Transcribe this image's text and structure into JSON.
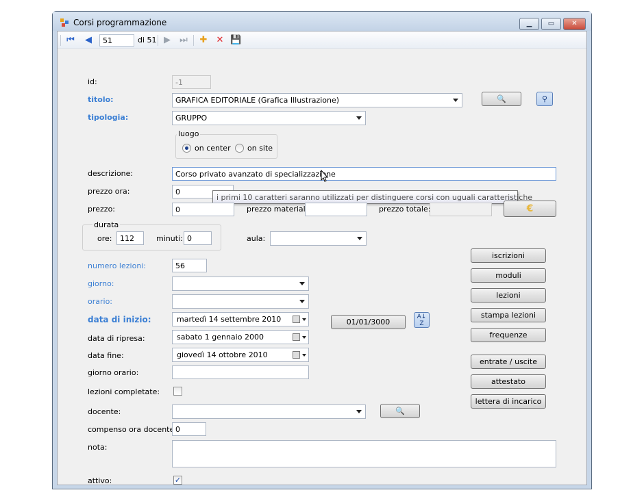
{
  "window": {
    "title": "Corsi programmazione"
  },
  "toolbar": {
    "record": "51",
    "of_label": "di 51"
  },
  "form": {
    "id_label": "id:",
    "id_value": "-1",
    "titolo_label": "titolo:",
    "titolo_value": "GRAFICA EDITORIALE (Grafica Illustrazione)",
    "tipologia_label": "tipologia:",
    "tipologia_value": "GRUPPO",
    "luogo_label": "luogo",
    "on_center": "on center",
    "on_site": "on site",
    "descrizione_label": "descrizione:",
    "descrizione_value": "Corso privato avanzato di specializzazione",
    "tooltip": "i primi 10 caratteri saranno utilizzati per distinguere corsi con uguali caratteristiche",
    "prezzo_ora_label": "prezzo ora:",
    "prezzo_ora_value": "0",
    "prezzo_label": "prezzo:",
    "prezzo_value": "0",
    "prezzo_materiali_label": "prezzo materiali:",
    "prezzo_materiali_value": "",
    "prezzo_totale_label": "prezzo totale:",
    "prezzo_totale_value": "",
    "durata_label": "durata",
    "ore_label": "ore:",
    "ore_value": "112",
    "minuti_label": "minuti:",
    "minuti_value": "0",
    "aula_label": "aula:",
    "aula_value": "",
    "numero_lezioni_label": "numero lezioni:",
    "numero_lezioni_value": "56",
    "giorno_label": "giorno:",
    "giorno_value": "",
    "orario_label": "orario:",
    "orario_value": "",
    "data_inizio_label": "data di inizio:",
    "data_inizio_value": "martedì   14 settembre  2010",
    "data_ripresa_label": "data di ripresa:",
    "data_ripresa_value": "sabato     1  gennaio   2000",
    "data_fine_label": "data fine:",
    "data_fine_value": "giovedì   14   ottobre   2010",
    "date_button": "01/01/3000",
    "giorno_orario_label": "giorno orario:",
    "giorno_orario_value": "",
    "lezioni_completate_label": "lezioni completate:",
    "docente_label": "docente:",
    "docente_value": "",
    "compenso_label": "compenso ora docente:",
    "compenso_value": "0",
    "nota_label": "nota:",
    "nota_value": "",
    "attivo_label": "attivo:"
  },
  "side_buttons": [
    "iscrizioni",
    "moduli",
    "lezioni",
    "stampa lezioni",
    "frequenze",
    "entrate / uscite",
    "attestato",
    "lettera di incarico"
  ],
  "colors": {
    "label_blue": "#3b7fd4",
    "close_red": "#c94a3a"
  }
}
